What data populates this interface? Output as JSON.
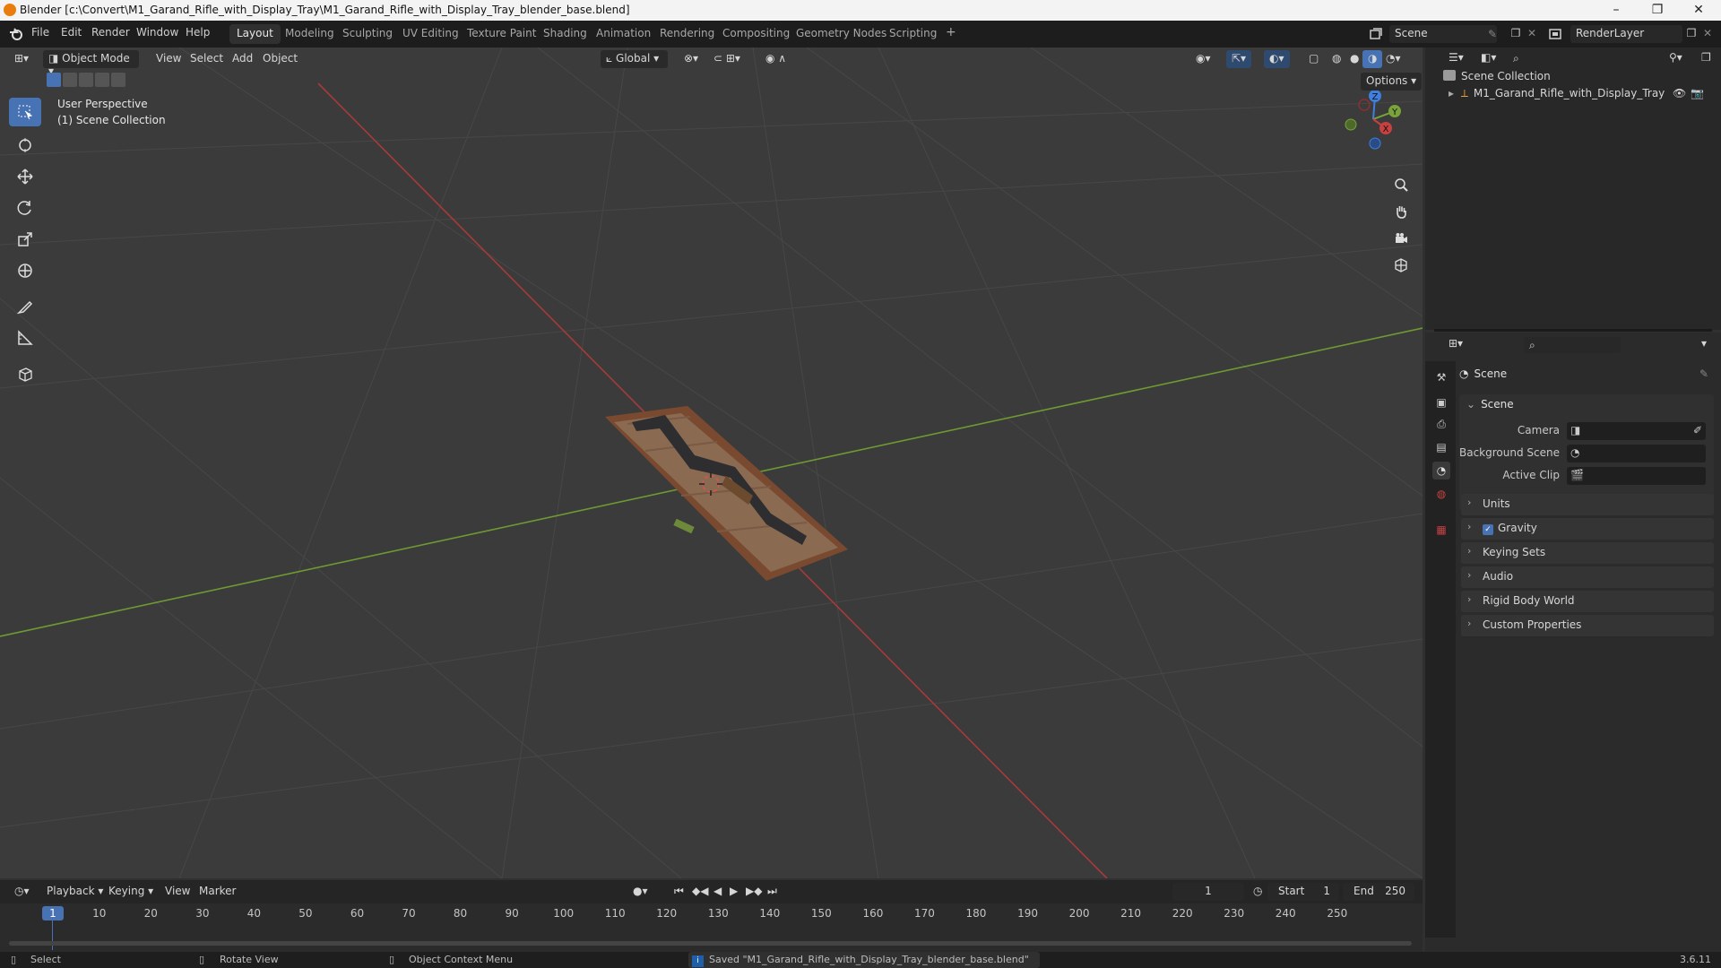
{
  "window": {
    "title": "Blender [c:\\Convert\\M1_Garand_Rifle_with_Display_Tray\\M1_Garand_Rifle_with_Display_Tray_blender_base.blend]",
    "controls": [
      "–",
      "❐",
      "✕"
    ]
  },
  "menus": [
    "File",
    "Edit",
    "Render",
    "Window",
    "Help"
  ],
  "workspaces": [
    "Layout",
    "Modeling",
    "Sculpting",
    "UV Editing",
    "Texture Paint",
    "Shading",
    "Animation",
    "Rendering",
    "Compositing",
    "Geometry Nodes",
    "Scripting"
  ],
  "active_workspace": "Layout",
  "add_workspace": "+",
  "scene_selector": "Scene",
  "render_layer": "RenderLayer",
  "viewport": {
    "mode": "Object Mode",
    "menus": [
      "View",
      "Select",
      "Add",
      "Object"
    ],
    "orientation": "Global",
    "options": "Options",
    "overlay_line1": "User Perspective",
    "overlay_line2": "(1) Scene Collection",
    "gizmo": {
      "x": "X",
      "y": "Y",
      "z": "Z"
    }
  },
  "outliner": {
    "root": "Scene Collection",
    "items": [
      {
        "label": "M1_Garand_Rifle_with_Display_Tray"
      }
    ]
  },
  "properties": {
    "header": "Scene",
    "section": "Scene",
    "fields": [
      {
        "label": "Camera"
      },
      {
        "label": "Background Scene"
      },
      {
        "label": "Active Clip"
      }
    ],
    "panels": [
      {
        "label": "Units",
        "checkbox": false
      },
      {
        "label": "Gravity",
        "checkbox": true,
        "checked": true
      },
      {
        "label": "Keying Sets",
        "checkbox": false
      },
      {
        "label": "Audio",
        "checkbox": false
      },
      {
        "label": "Rigid Body World",
        "checkbox": false
      },
      {
        "label": "Custom Properties",
        "checkbox": false
      }
    ]
  },
  "timeline": {
    "menus": [
      "Playback",
      "Keying",
      "View",
      "Marker"
    ],
    "current_frame": "1",
    "start_label": "Start",
    "start": "1",
    "end_label": "End",
    "end": "250",
    "ticks": [
      "1",
      "10",
      "20",
      "30",
      "40",
      "50",
      "60",
      "70",
      "80",
      "90",
      "100",
      "110",
      "120",
      "130",
      "140",
      "150",
      "160",
      "170",
      "180",
      "190",
      "200",
      "210",
      "220",
      "230",
      "240",
      "250"
    ]
  },
  "status": {
    "select": "Select",
    "rotate": "Rotate View",
    "context": "Object Context Menu",
    "message": "Saved \"M1_Garand_Rifle_with_Display_Tray_blender_base.blend\"",
    "version": "3.6.11"
  },
  "colors": {
    "accent": "#4772b3",
    "x_axis": "#c84040",
    "y_axis": "#7aa33a",
    "z_axis": "#3f7fe0"
  }
}
